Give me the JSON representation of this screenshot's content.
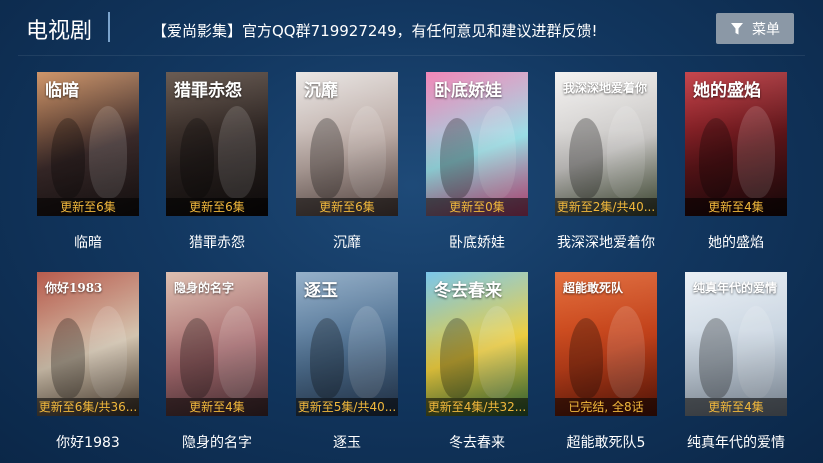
{
  "header": {
    "title": "电视剧",
    "notice": "【爱尚影集】官方QQ群719927249，有任何意见和建议进群反馈!",
    "menu_label": "菜单",
    "menu_icon": "filter-icon"
  },
  "shows": [
    {
      "title": "临暗",
      "status": "更新至6集",
      "poster_text": "临暗",
      "colors": [
        "#c98a5a",
        "#3a2a2a",
        "#1a1414"
      ]
    },
    {
      "title": "猎罪赤怨",
      "status": "更新至6集",
      "poster_text": "猎罪赤怨",
      "colors": [
        "#5a4a40",
        "#2a2220",
        "#120e0d"
      ]
    },
    {
      "title": "沉靡",
      "status": "更新至6集",
      "poster_text": "沉靡",
      "colors": [
        "#e8e4e2",
        "#b9a8a2",
        "#6e5a55"
      ]
    },
    {
      "title": "卧底娇娃",
      "status": "更新至0集",
      "poster_text": "卧底娇娃",
      "colors": [
        "#f07ab0",
        "#9be0e8",
        "#e04f8c"
      ]
    },
    {
      "title": "我深深地爱着你",
      "status": "更新至2集/共40...",
      "poster_text": "我深深地爱着你",
      "colors": [
        "#f3f1f0",
        "#c8c6c4",
        "#4e5a3e"
      ]
    },
    {
      "title": "她的盛焰",
      "status": "更新至4集",
      "poster_text": "她的盛焰",
      "colors": [
        "#c0323a",
        "#5a1418",
        "#1e0a0c"
      ]
    },
    {
      "title": "你好1983",
      "status": "更新至6集/共36...",
      "poster_text": "你好1983",
      "colors": [
        "#b04a3a",
        "#d6c7b2",
        "#5a4a3a"
      ]
    },
    {
      "title": "隐身的名字",
      "status": "更新至4集",
      "poster_text": "隐身的名字",
      "colors": [
        "#d9b8a8",
        "#a86c70",
        "#5a3a40"
      ]
    },
    {
      "title": "逐玉",
      "status": "更新至5集/共40...",
      "poster_text": "逐玉",
      "colors": [
        "#8aa8c4",
        "#4e6f90",
        "#2a3e58"
      ]
    },
    {
      "title": "冬去春来",
      "status": "更新至4集/共32...",
      "poster_text": "冬去春来",
      "colors": [
        "#6cc0e8",
        "#f0d040",
        "#3a7a40"
      ]
    },
    {
      "title": "超能敢死队5",
      "status": "已完结, 全8话",
      "poster_text": "超能敢死队",
      "colors": [
        "#e0602a",
        "#c0401a",
        "#6a1a0a"
      ]
    },
    {
      "title": "纯真年代的爱情",
      "status": "更新至4集",
      "poster_text": "纯真年代的爱情",
      "colors": [
        "#e8eef4",
        "#c8d4e0",
        "#9aa8b8"
      ]
    }
  ]
}
